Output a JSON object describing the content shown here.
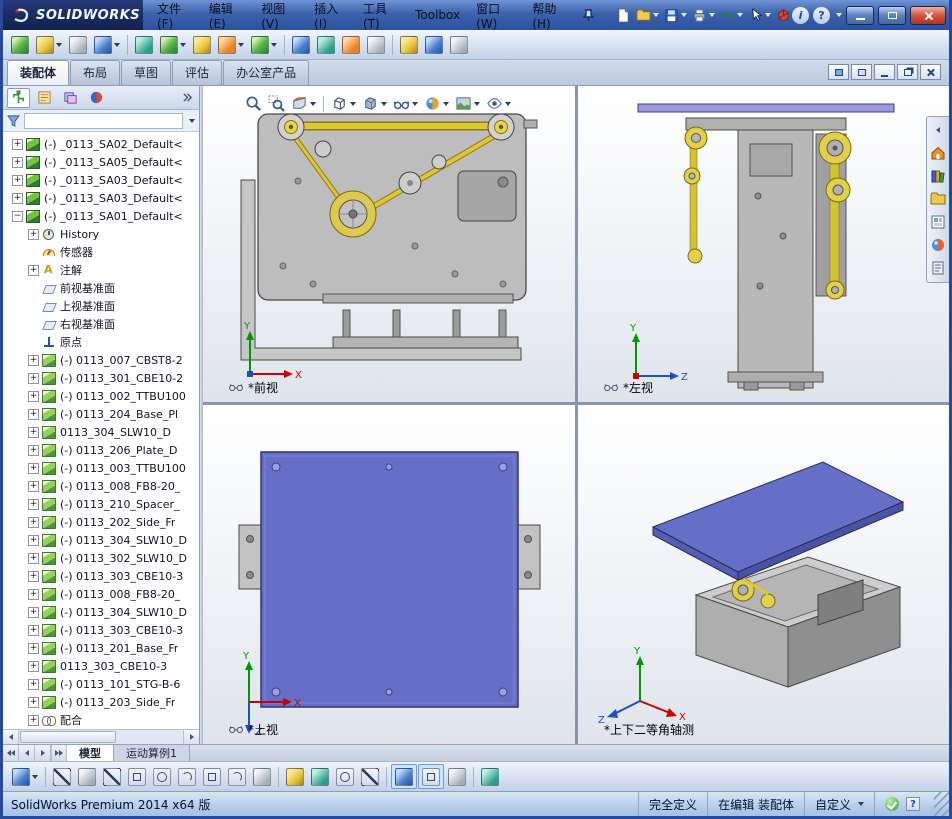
{
  "titlebar": {
    "brand": "SOLIDWORKS",
    "menus": [
      "文件(F)",
      "编辑(E)",
      "视图(V)",
      "插入(I)",
      "工具(T)",
      "Toolbox",
      "窗口(W)",
      "帮助(H)"
    ]
  },
  "command_tabs": {
    "tabs": [
      {
        "label": "装配体",
        "cls": "active"
      },
      {
        "label": "布局",
        "cls": ""
      },
      {
        "label": "草图",
        "cls": ""
      },
      {
        "label": "评估",
        "cls": ""
      },
      {
        "label": "办公室产品",
        "cls": ""
      }
    ]
  },
  "feature_tree": {
    "rows": [
      {
        "label": "(-) _0113_SA02_Default<",
        "cls": "ind0 exp-plus ic-asm"
      },
      {
        "label": "(-) _0113_SA05_Default<",
        "cls": "ind0 exp-plus ic-asm"
      },
      {
        "label": "(-) _0113_SA03_Default<",
        "cls": "ind0 exp-plus ic-asm"
      },
      {
        "label": "(-) _0113_SA03_Default<",
        "cls": "ind0 exp-plus ic-asm"
      },
      {
        "label": "(-) _0113_SA01_Default<",
        "cls": "ind0 exp-minus ic-asm"
      },
      {
        "label": "History",
        "cls": "ind1 exp-plus ic-hist"
      },
      {
        "label": "传感器",
        "cls": "ind1 exp-none ic-sensor"
      },
      {
        "label": "注解",
        "cls": "ind1 exp-plus ic-annot"
      },
      {
        "label": "前视基准面",
        "cls": "ind1 exp-none ic-plane"
      },
      {
        "label": "上视基准面",
        "cls": "ind1 exp-none ic-plane"
      },
      {
        "label": "右视基准面",
        "cls": "ind1 exp-none ic-plane"
      },
      {
        "label": "原点",
        "cls": "ind1 exp-none ic-origin"
      },
      {
        "label": "(-) 0113_007_CBST8-2",
        "cls": "ind1 exp-plus ic-part"
      },
      {
        "label": "(-) 0113_301_CBE10-2",
        "cls": "ind1 exp-plus ic-part"
      },
      {
        "label": "(-) 0113_002_TTBU100",
        "cls": "ind1 exp-plus ic-part"
      },
      {
        "label": "(-) 0113_204_Base_Pl",
        "cls": "ind1 exp-plus ic-part"
      },
      {
        "label": "0113_304_SLW10_D",
        "cls": "ind1 exp-plus ic-part"
      },
      {
        "label": "(-) 0113_206_Plate_D",
        "cls": "ind1 exp-plus ic-part"
      },
      {
        "label": "(-) 0113_003_TTBU100",
        "cls": "ind1 exp-plus ic-part"
      },
      {
        "label": "(-) 0113_008_FB8-20_",
        "cls": "ind1 exp-plus ic-part"
      },
      {
        "label": "(-) 0113_210_Spacer_",
        "cls": "ind1 exp-plus ic-part"
      },
      {
        "label": "(-) 0113_202_Side_Fr",
        "cls": "ind1 exp-plus ic-part"
      },
      {
        "label": "(-) 0113_304_SLW10_D",
        "cls": "ind1 exp-plus ic-part"
      },
      {
        "label": "(-) 0113_302_SLW10_D",
        "cls": "ind1 exp-plus ic-part"
      },
      {
        "label": "(-) 0113_303_CBE10-3",
        "cls": "ind1 exp-plus ic-part"
      },
      {
        "label": "(-) 0113_008_FB8-20_",
        "cls": "ind1 exp-plus ic-part"
      },
      {
        "label": "(-) 0113_304_SLW10_D",
        "cls": "ind1 exp-plus ic-part"
      },
      {
        "label": "(-) 0113_303_CBE10-3",
        "cls": "ind1 exp-plus ic-part"
      },
      {
        "label": "(-) 0113_201_Base_Fr",
        "cls": "ind1 exp-plus ic-part"
      },
      {
        "label": "0113_303_CBE10-3",
        "cls": "ind1 exp-plus ic-part"
      },
      {
        "label": "(-) 0113_101_STG-B-6",
        "cls": "ind1 exp-plus ic-part"
      },
      {
        "label": "(-) 0113_203_Side_Fr",
        "cls": "ind1 exp-plus ic-part"
      },
      {
        "label": "配合",
        "cls": "ind1 exp-plus ic-mates"
      }
    ]
  },
  "viewport": {
    "views": {
      "front": "*前视",
      "left": "*左视",
      "top": "*上视",
      "iso": "*上下二等角轴测"
    }
  },
  "model_tabs": {
    "tabs": [
      {
        "label": "模型",
        "cls": "active"
      },
      {
        "label": "运动算例1",
        "cls": ""
      }
    ]
  },
  "statusbar": {
    "app": "SolidWorks Premium 2014 x64 版",
    "define_state": "完全定义",
    "edit_state": "在编辑 装配体",
    "custom": "自定义"
  }
}
